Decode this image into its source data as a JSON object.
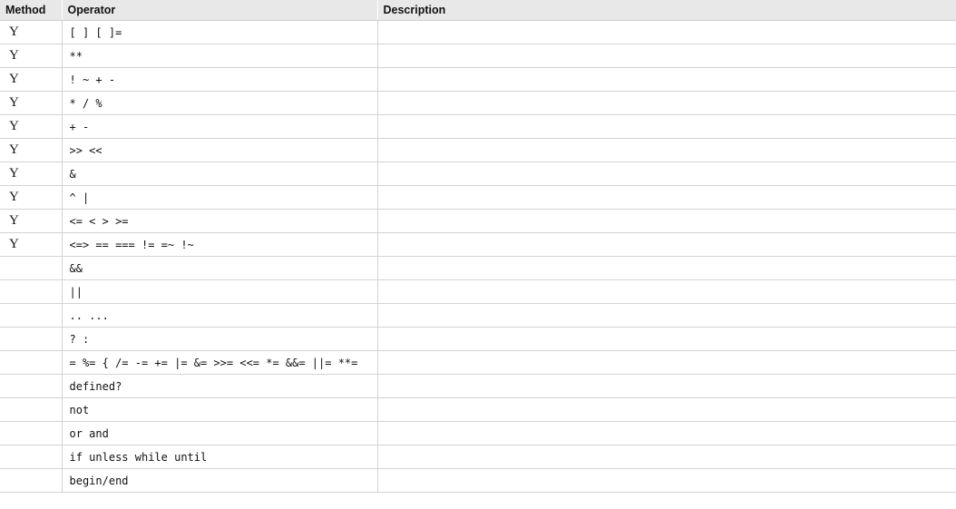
{
  "table": {
    "headers": {
      "method": "Method",
      "operator": "Operator",
      "description": "Description"
    },
    "rows": [
      {
        "method": "Y",
        "operator": "[ ] [ ]=",
        "description": ""
      },
      {
        "method": "Y",
        "operator": "**",
        "description": ""
      },
      {
        "method": "Y",
        "operator": "! ~ + -",
        "description": ""
      },
      {
        "method": "Y",
        "operator": "* / %",
        "description": ""
      },
      {
        "method": "Y",
        "operator": "+ -",
        "description": ""
      },
      {
        "method": "Y",
        "operator": ">> <<",
        "description": ""
      },
      {
        "method": "Y",
        "operator": "&",
        "description": ""
      },
      {
        "method": "Y",
        "operator": "^ |",
        "description": ""
      },
      {
        "method": "Y",
        "operator": "<= < > >=",
        "description": ""
      },
      {
        "method": "Y",
        "operator": "<=> == === != =~ !~",
        "description": ""
      },
      {
        "method": "",
        "operator": "&&",
        "description": ""
      },
      {
        "method": "",
        "operator": "||",
        "description": ""
      },
      {
        "method": "",
        "operator": ".. ...",
        "description": ""
      },
      {
        "method": "",
        "operator": "? :",
        "description": ""
      },
      {
        "method": "",
        "operator": "= %= { /= -= += |= &= >>= <<= *= &&= ||= **=",
        "description": ""
      },
      {
        "method": "",
        "operator": "defined?",
        "description": ""
      },
      {
        "method": "",
        "operator": "not",
        "description": ""
      },
      {
        "method": "",
        "operator": "or and",
        "description": ""
      },
      {
        "method": "",
        "operator": "if unless while until",
        "description": ""
      },
      {
        "method": "",
        "operator": "begin/end",
        "description": ""
      }
    ]
  }
}
